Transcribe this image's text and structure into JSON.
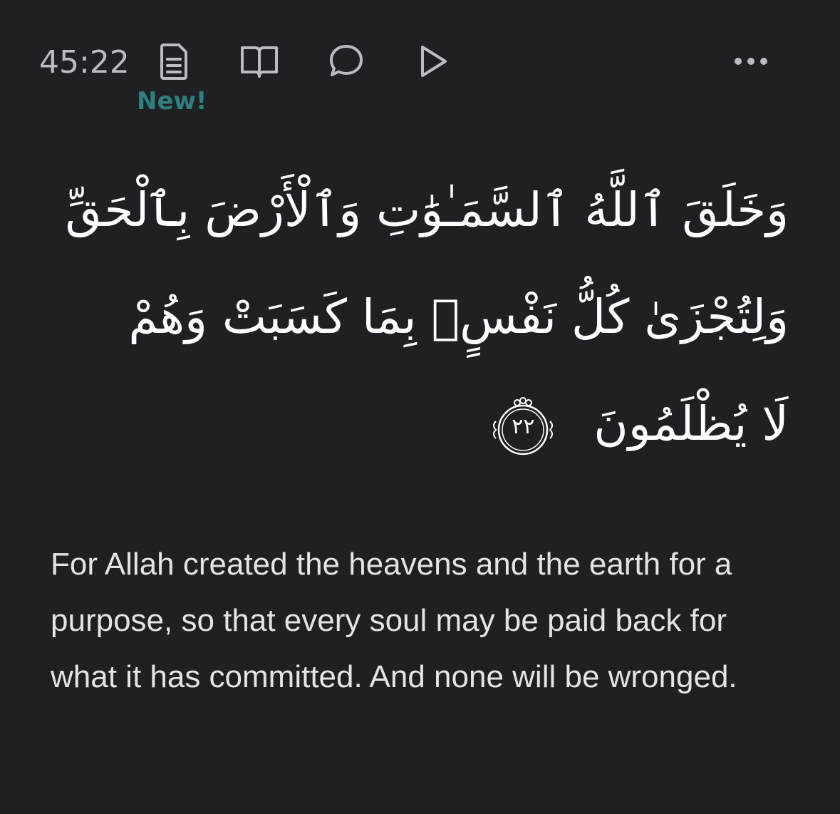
{
  "toolbar": {
    "verse_key": "45:22",
    "new_badge": "New!",
    "icons": {
      "tafsir": "document-icon",
      "reflect": "open-book-icon",
      "comment": "chat-bubble-icon",
      "play": "play-icon",
      "more": "more-dots-icon"
    }
  },
  "verse": {
    "arabic_lines": [
      "وَخَلَقَ ٱللَّهُ ٱلسَّمَـٰوَٰتِ وَٱلْأَرْضَ بِٱلْحَقِّ",
      "وَلِتُجْزَىٰ كُلُّ نَفْسٍۭ بِمَا كَسَبَتْ وَهُمْ",
      "لَا يُظْلَمُونَ"
    ],
    "ayah_number": "٢٢",
    "translation": "For Allah created the heavens and the earth for a purpose, so that every soul may be paid back for what it has committed. And none will be wronged."
  },
  "colors": {
    "background": "#1f2023",
    "accent_new": "#2f7f80",
    "icon": "#b9bcc2",
    "text": "#e4e4e6"
  }
}
